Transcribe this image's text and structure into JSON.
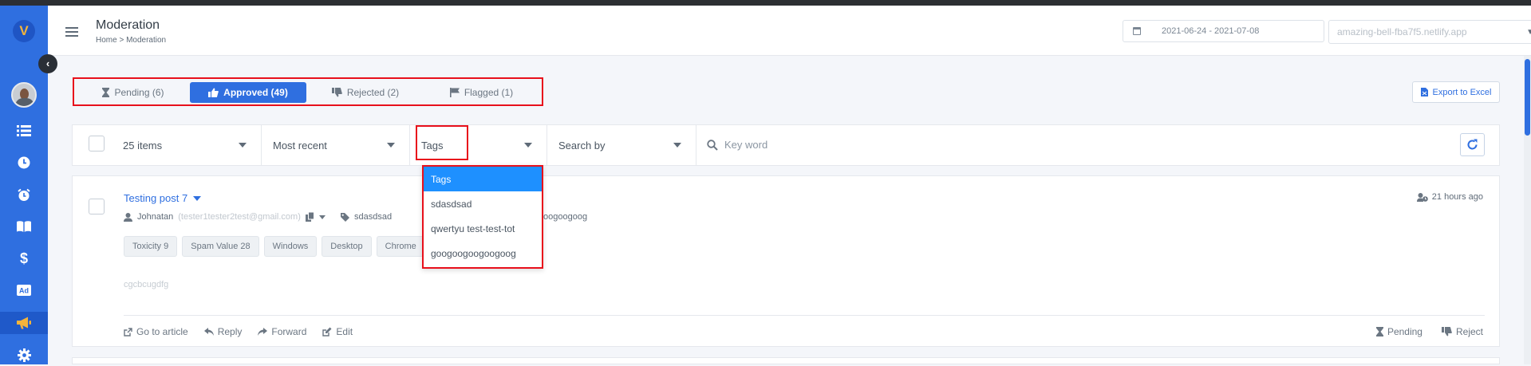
{
  "header": {
    "title": "Moderation",
    "breadcrumb": "Home  > Moderation",
    "date_range": "2021-06-24 - 2021-07-08",
    "site": "amazing-bell-fba7f5.netlify.app"
  },
  "sidebar": {
    "logo": "V",
    "items": [
      {
        "icon": "list-icon"
      },
      {
        "icon": "clock-icon"
      },
      {
        "icon": "alarm-icon"
      },
      {
        "icon": "book-icon"
      },
      {
        "icon": "dollar-icon"
      },
      {
        "icon": "ad-icon",
        "label": "Ad"
      },
      {
        "icon": "megaphone-icon",
        "active": true
      },
      {
        "icon": "gear-icon"
      }
    ]
  },
  "tabs": [
    {
      "label": "Pending (6)",
      "icon": "hourglass-icon"
    },
    {
      "label": "Approved (49)",
      "icon": "thumbs-up-icon",
      "active": true
    },
    {
      "label": "Rejected (2)",
      "icon": "thumbs-down-icon"
    },
    {
      "label": "Flagged (1)",
      "icon": "flag-icon"
    }
  ],
  "export_label": "Export to Excel",
  "filters": {
    "items": "25 items",
    "sort": "Most recent",
    "tags": "Tags",
    "search_by": "Search by",
    "keyword_placeholder": "Key word"
  },
  "tags_dropdown": [
    "Tags",
    "sdasdsad",
    "qwertyu test-test-tot",
    "googoogoogoogoog"
  ],
  "post": {
    "title": "Testing post 7",
    "author": "Johnatan",
    "email": "(tester1tester2test@gmail.com)",
    "tag_1": "sdasdsad",
    "tag_tail": "oogoogoog",
    "time": "21 hours ago",
    "chips": [
      "Toxicity 9",
      "Spam Value 28",
      "Windows",
      "Desktop",
      "Chrome"
    ],
    "body": "cgcbcugdfg",
    "actions": [
      "Go to article",
      "Reply",
      "Forward",
      "Edit"
    ],
    "right_actions": [
      "Pending",
      "Reject"
    ]
  },
  "colors": {
    "primary": "#2f6fe0",
    "highlight": "#e8101b",
    "dropdown_selected": "#1e90ff"
  }
}
